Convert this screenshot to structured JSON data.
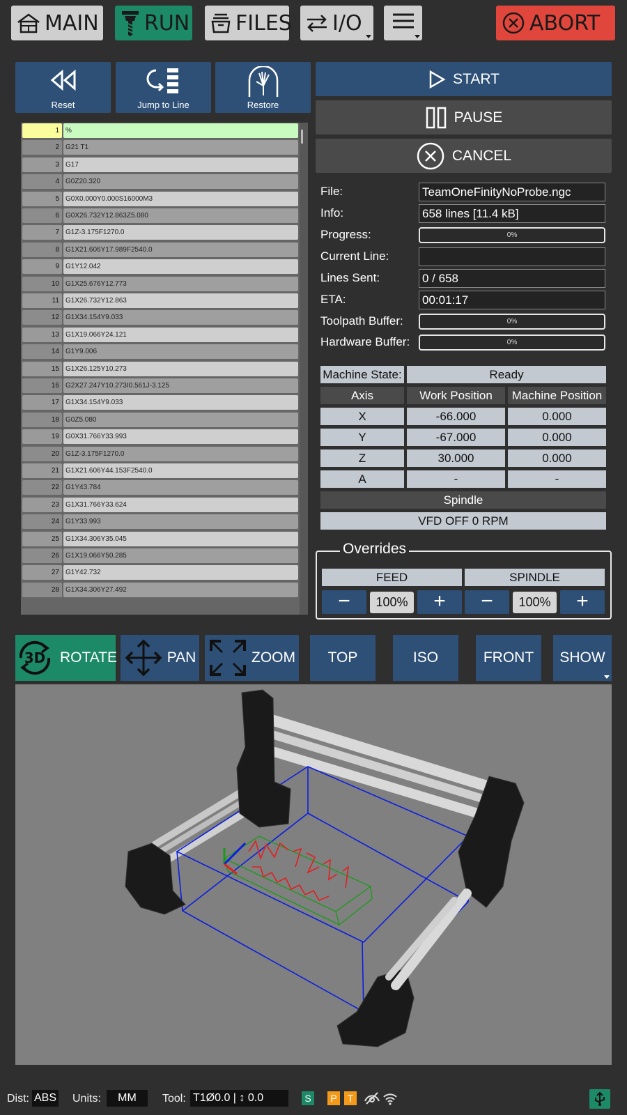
{
  "nav": {
    "main": "MAIN",
    "run": "RUN",
    "files": "FILES",
    "io": "I/O",
    "abort": "ABORT"
  },
  "controls": {
    "reset": "Reset",
    "jump": "Jump to Line",
    "restore": "Restore",
    "start": "START",
    "pause": "PAUSE",
    "cancel": "CANCEL"
  },
  "gcode": [
    {
      "n": "1",
      "code": "%"
    },
    {
      "n": "2",
      "code": "G21 T1"
    },
    {
      "n": "3",
      "code": "G17"
    },
    {
      "n": "4",
      "code": "G0Z20.320"
    },
    {
      "n": "5",
      "code": "G0X0.000Y0.000S16000M3"
    },
    {
      "n": "6",
      "code": "G0X26.732Y12.863Z5.080"
    },
    {
      "n": "7",
      "code": "G1Z-3.175F1270.0"
    },
    {
      "n": "8",
      "code": "G1X21.606Y17.989F2540.0"
    },
    {
      "n": "9",
      "code": "G1Y12.042"
    },
    {
      "n": "10",
      "code": "G1X25.676Y12.773"
    },
    {
      "n": "11",
      "code": "G1X26.732Y12.863"
    },
    {
      "n": "12",
      "code": "G1X34.154Y9.033"
    },
    {
      "n": "13",
      "code": "G1X19.066Y24.121"
    },
    {
      "n": "14",
      "code": "G1Y9.006"
    },
    {
      "n": "15",
      "code": "G1X26.125Y10.273"
    },
    {
      "n": "16",
      "code": "G2X27.247Y10.273I0.561J-3.125"
    },
    {
      "n": "17",
      "code": "G1X34.154Y9.033"
    },
    {
      "n": "18",
      "code": "G0Z5.080"
    },
    {
      "n": "19",
      "code": "G0X31.766Y33.993"
    },
    {
      "n": "20",
      "code": "G1Z-3.175F1270.0"
    },
    {
      "n": "21",
      "code": "G1X21.606Y44.153F2540.0"
    },
    {
      "n": "22",
      "code": "G1Y43.784"
    },
    {
      "n": "23",
      "code": "G1X31.766Y33.624"
    },
    {
      "n": "24",
      "code": "G1Y33.993"
    },
    {
      "n": "25",
      "code": "G1X34.306Y35.045"
    },
    {
      "n": "26",
      "code": "G1X19.066Y50.285"
    },
    {
      "n": "27",
      "code": "G1Y42.732"
    },
    {
      "n": "28",
      "code": "G1X34.306Y27.492"
    }
  ],
  "info": {
    "file_label": "File:",
    "file": "TeamOneFinityNoProbe.ngc",
    "info_label": "Info:",
    "info": "658 lines [11.4 kB]",
    "progress_label": "Progress:",
    "progress": "0%",
    "progress_value": 0,
    "current_label": "Current Line:",
    "current": "",
    "sent_label": "Lines Sent:",
    "sent": "0 / 658",
    "eta_label": "ETA:",
    "eta": "00:01:17",
    "toolpath_label": "Toolpath Buffer:",
    "toolpath": "0%",
    "toolpath_value": 0,
    "hardware_label": "Hardware Buffer:",
    "hardware": "0%",
    "hardware_value": 0
  },
  "machine": {
    "state_label": "Machine State:",
    "state": "Ready",
    "axis_header": "Axis",
    "work_header": "Work Position",
    "machine_header": "Machine Position",
    "axes": [
      {
        "name": "X",
        "work": "-66.000",
        "machine": "0.000"
      },
      {
        "name": "Y",
        "work": "-67.000",
        "machine": "0.000"
      },
      {
        "name": "Z",
        "work": "30.000",
        "machine": "0.000"
      },
      {
        "name": "A",
        "work": "-",
        "machine": "-"
      }
    ],
    "spindle_header": "Spindle",
    "spindle": "VFD OFF 0 RPM"
  },
  "overrides": {
    "title": "Overrides",
    "feed_label": "FEED",
    "spindle_label": "SPINDLE",
    "feed": "100%",
    "spindle": "100%",
    "minus": "−",
    "plus": "+"
  },
  "view": {
    "rotate": "ROTATE",
    "rotate_badge": "3D",
    "pan": "PAN",
    "zoom": "ZOOM",
    "top": "TOP",
    "iso": "ISO",
    "front": "FRONT",
    "show": "SHOW"
  },
  "status": {
    "dist_label": "Dist:",
    "dist": "ABS",
    "units_label": "Units:",
    "units": "MM",
    "tool_label": "Tool:",
    "tool": "T1Ø0.0 | ↕ 0.0",
    "s_badge": "S",
    "p_badge": "P",
    "t_badge": "T"
  },
  "colors": {
    "accent_green": "#1d8a67",
    "abort_red": "#e1463c",
    "button_blue": "#2e5077",
    "toolpath_red": "#e02020",
    "bounds_blue": "#0a1ee0"
  }
}
